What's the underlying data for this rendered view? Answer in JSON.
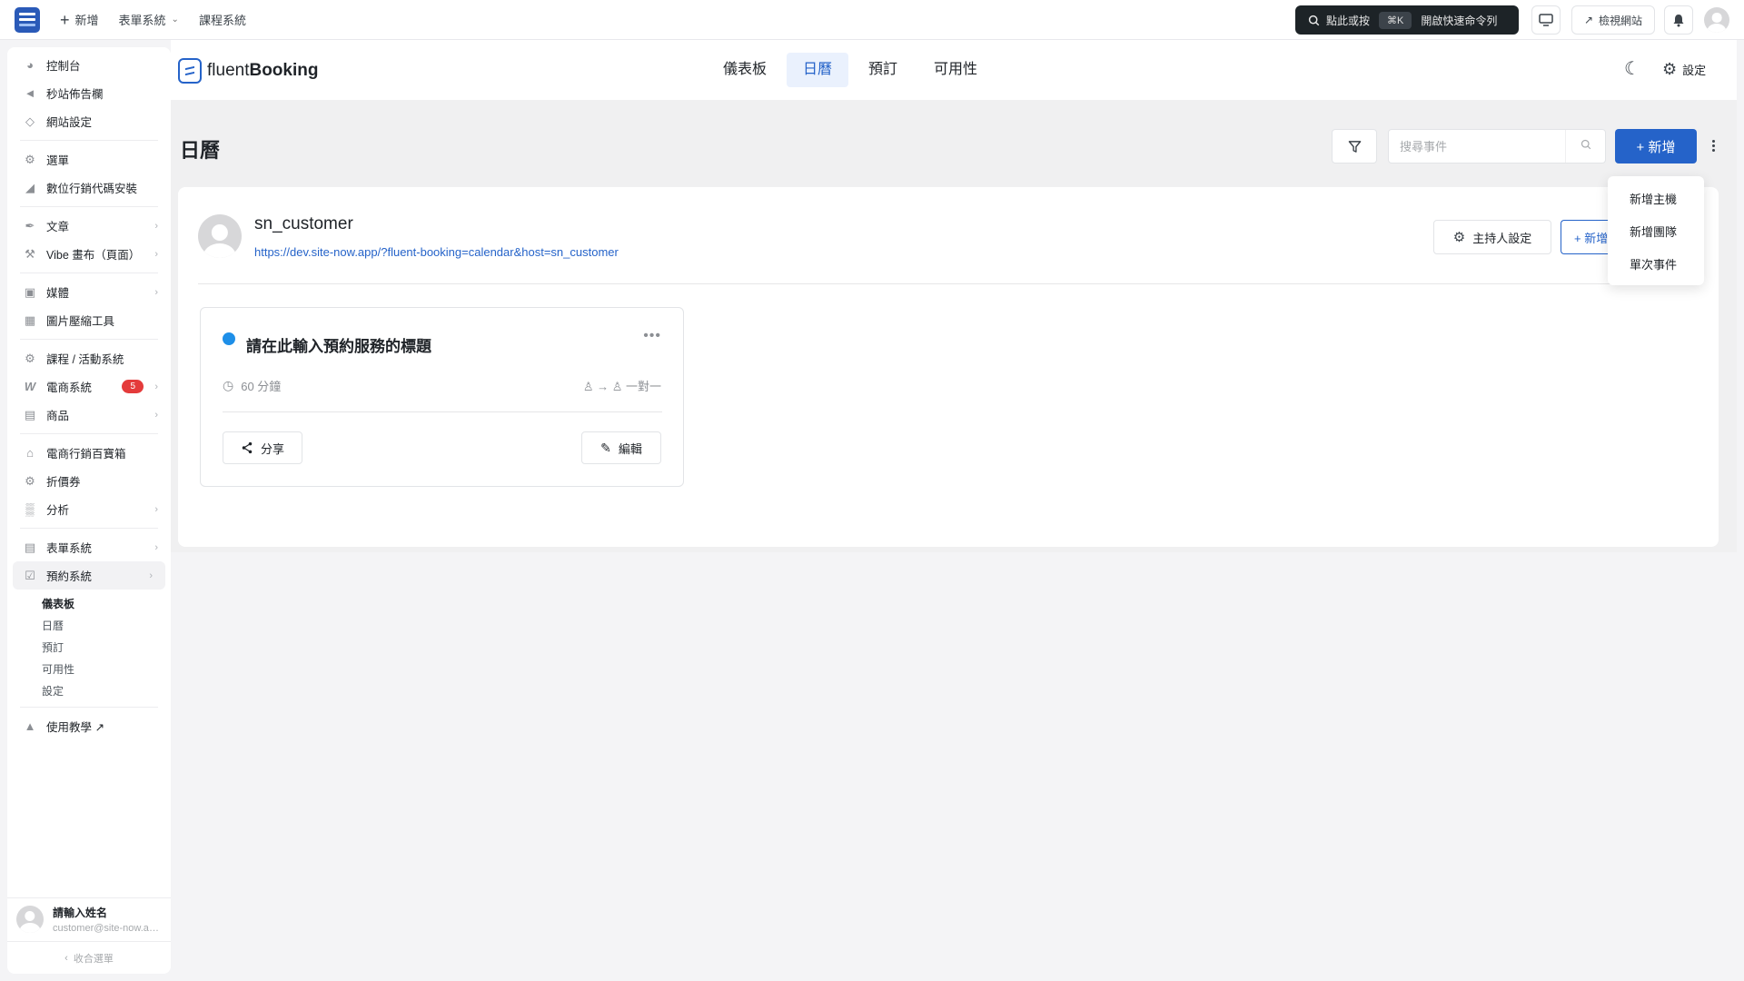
{
  "topbar": {
    "new_label": "新增",
    "forms_label": "表單系統",
    "courses_label": "課程系統",
    "command_prefix": "點此或按",
    "command_key": "⌘K",
    "command_suffix": "開啟快速命令列",
    "view_site_label": "檢視網站"
  },
  "sidebar": {
    "items": [
      {
        "label": "控制台",
        "icon": "dashboard-icon"
      },
      {
        "label": "秒站佈告欄",
        "icon": "megaphone-icon"
      },
      {
        "label": "網站設定",
        "icon": "diamond-icon"
      },
      {
        "label": "選單",
        "icon": "gear-icon"
      },
      {
        "label": "數位行銷代碼安裝",
        "icon": "chart-icon"
      },
      {
        "label": "文章",
        "icon": "pin-icon"
      },
      {
        "label": "Vibe 畫布（頁面）",
        "icon": "hammer-icon"
      },
      {
        "label": "媒體",
        "icon": "media-icon"
      },
      {
        "label": "圖片壓縮工具",
        "icon": "compress-icon"
      },
      {
        "label": "課程 / 活動系統",
        "icon": "gear-icon"
      },
      {
        "label": "電商系統",
        "icon": "woo-icon",
        "badge": "5"
      },
      {
        "label": "商品",
        "icon": "box-icon"
      },
      {
        "label": "電商行銷百寶箱",
        "icon": "store-icon"
      },
      {
        "label": "折價券",
        "icon": "gear-icon"
      },
      {
        "label": "分析",
        "icon": "bar-chart-icon"
      },
      {
        "label": "表單系統",
        "icon": "form-icon"
      },
      {
        "label": "預約系統",
        "icon": "booking-icon"
      },
      {
        "label": "使用教學 ↗",
        "icon": "graduation-icon"
      }
    ],
    "submenu": [
      "儀表板",
      "日曆",
      "預訂",
      "可用性",
      "設定"
    ],
    "user_name": "請輸入姓名",
    "user_email": "customer@site-now.app",
    "collapse_label": "收合選單"
  },
  "app": {
    "brand_light": "fluent",
    "brand_bold": "Booking",
    "tabs": [
      "儀表板",
      "日曆",
      "預訂",
      "可用性"
    ],
    "active_tab": "日曆",
    "settings_label": "設定"
  },
  "page": {
    "title": "日曆",
    "search_placeholder": "搜尋事件",
    "add_label": "+ 新增"
  },
  "host": {
    "name": "sn_customer",
    "url": "https://dev.site-now.app/?fluent-booking=calendar&host=sn_customer",
    "settings_label": "主持人設定",
    "new_label": "+ 新增"
  },
  "event": {
    "title": "請在此輸入預約服務的標題",
    "duration": "60 分鐘",
    "type": "一對一",
    "share_label": "分享",
    "edit_label": "編輯",
    "color": "#1e8fe8"
  },
  "dropdown": [
    "新增主機",
    "新增團隊",
    "單次事件"
  ],
  "colors": {
    "accent": "#2563c9",
    "badge": "#e43b3b"
  }
}
